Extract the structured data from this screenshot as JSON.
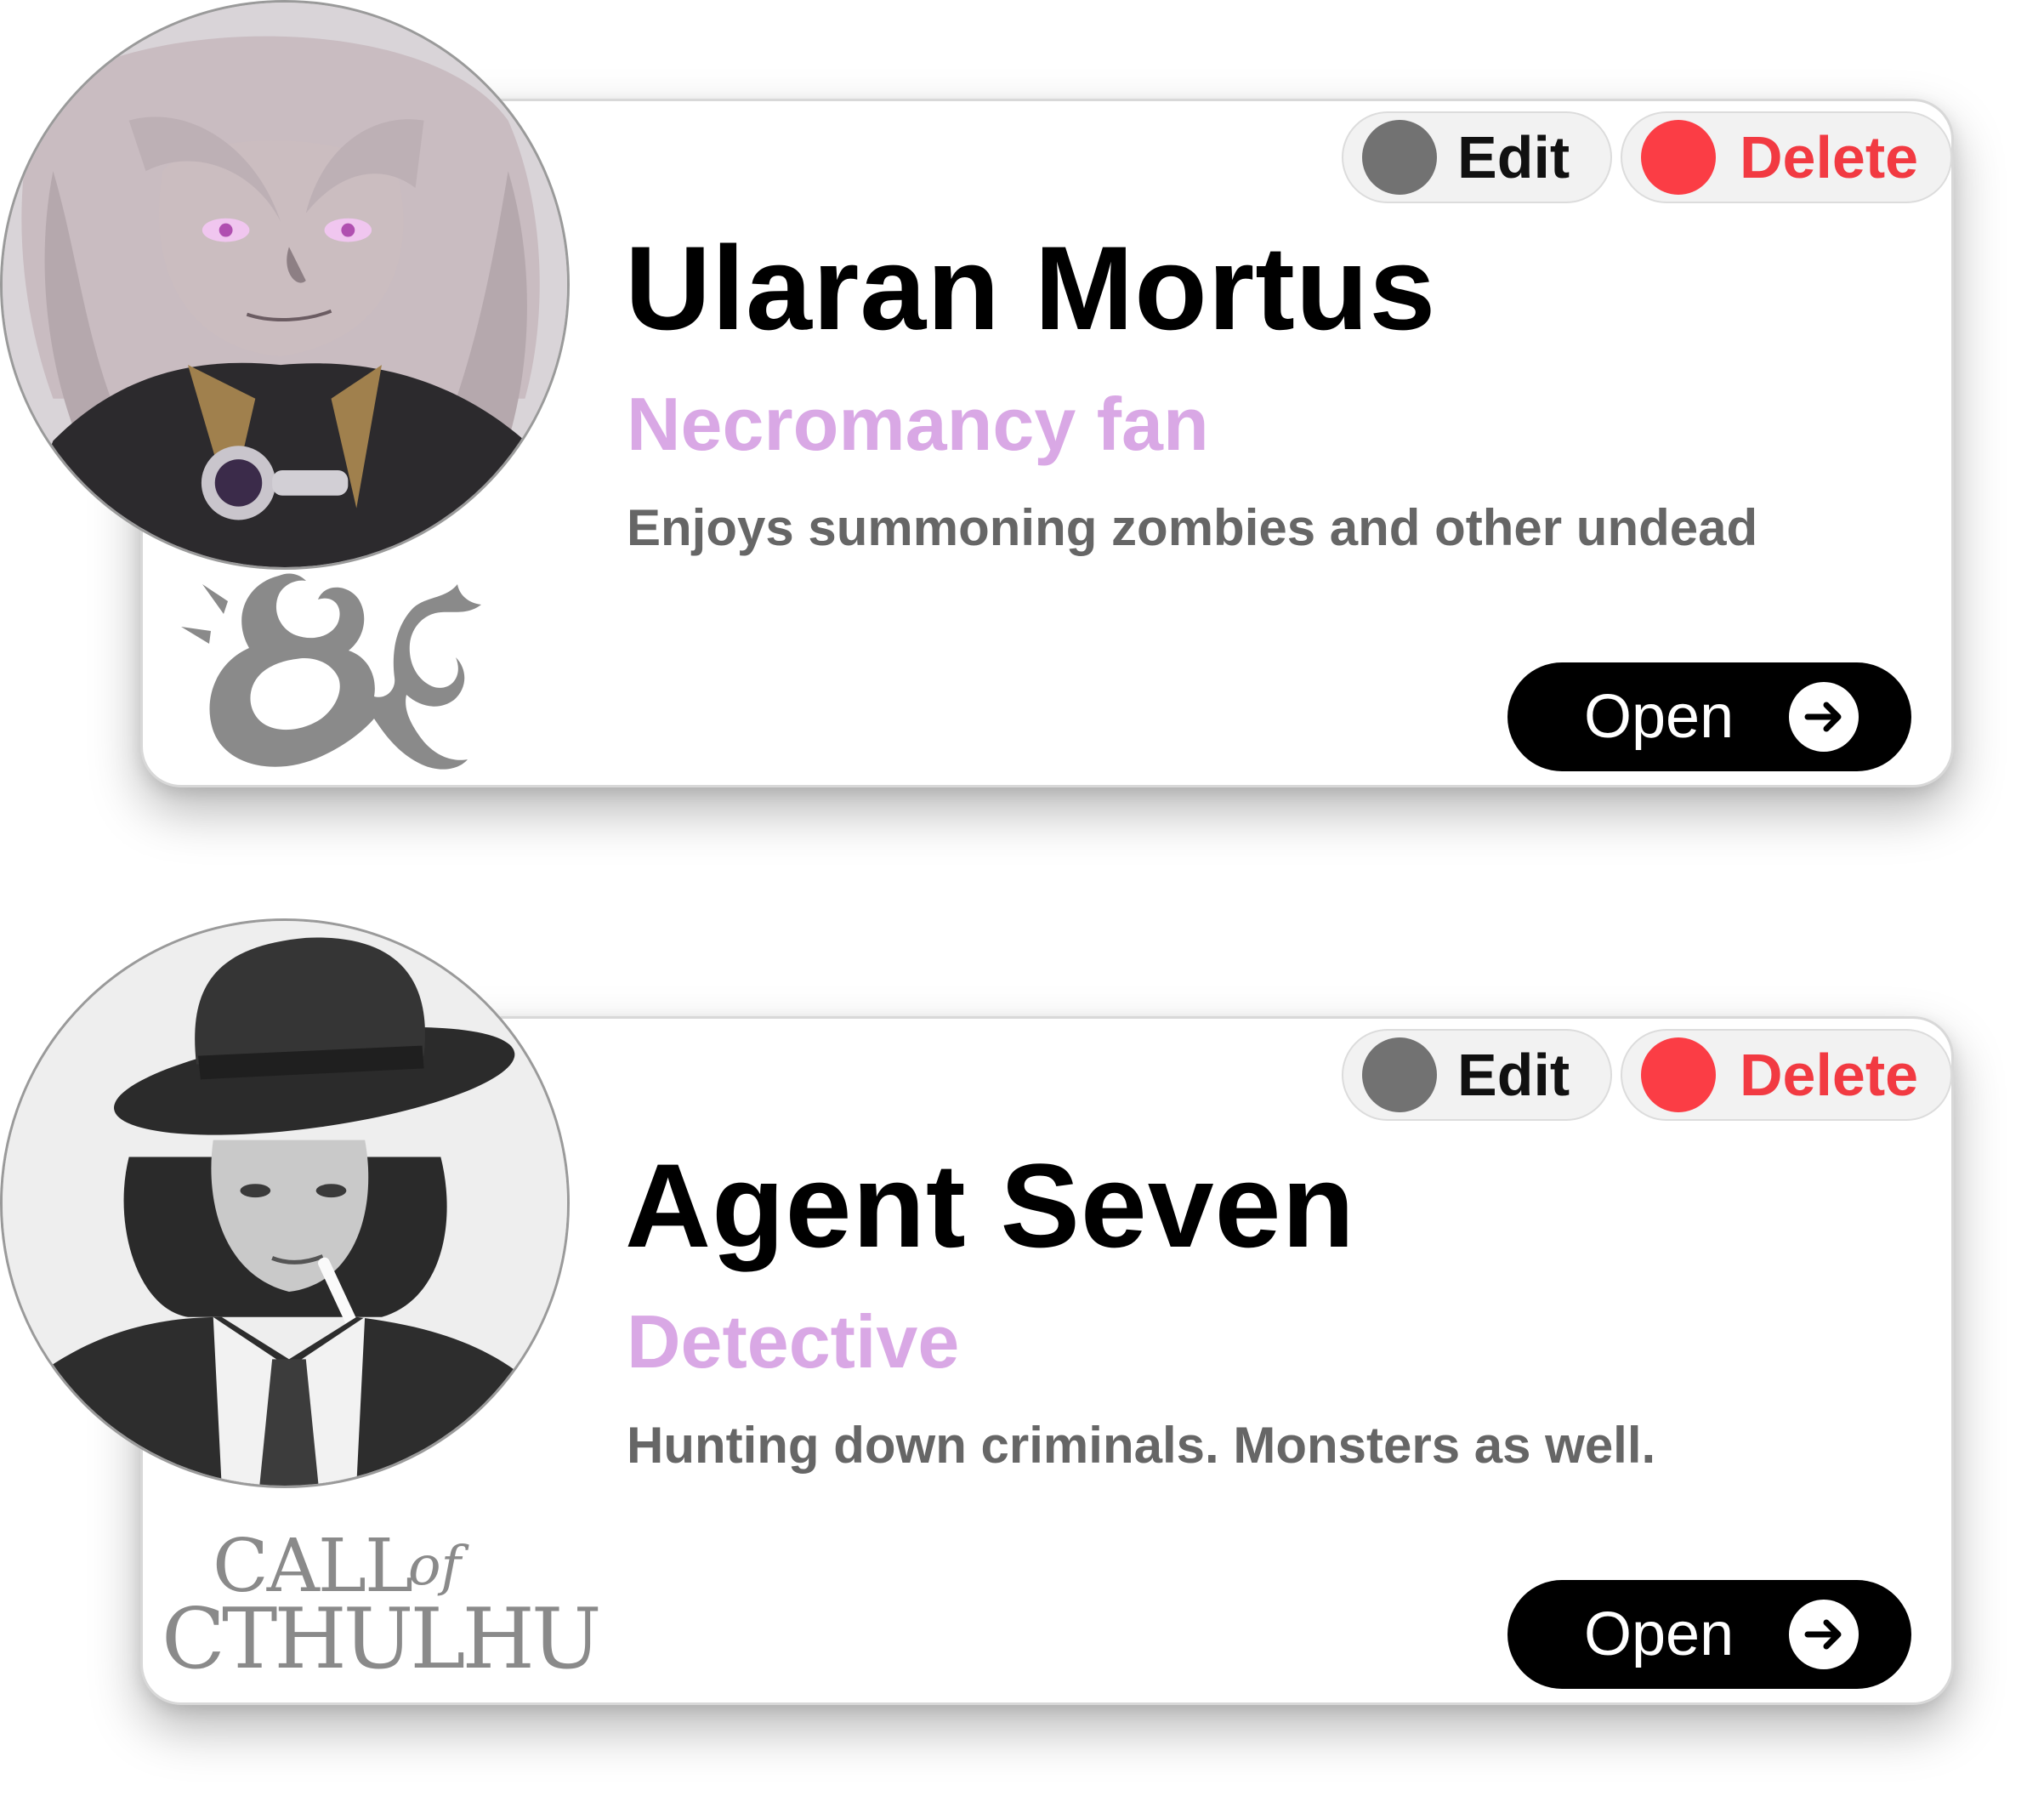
{
  "characters": [
    {
      "name": "Ularan Mortus",
      "role": "Necromancy fan",
      "description": "Enjoys summoning zombies and other undead",
      "edit_label": "Edit",
      "delete_label": "Delete",
      "open_label": "Open",
      "game_logo_text": "&",
      "avatar_icon": "anime-necromancer-portrait"
    },
    {
      "name": "Agent Seven",
      "role": "Detective",
      "description": "Hunting down criminals. Monsters as well.",
      "edit_label": "Edit",
      "delete_label": "Delete",
      "open_label": "Open",
      "game_logo_text": "CALL of CTHULHU",
      "avatar_icon": "detective-photo-portrait"
    }
  ],
  "colors": {
    "role": "#d9a8e5",
    "description": "#666666",
    "edit_dot": "#727272",
    "delete_dot": "#fb3d45",
    "delete_text": "#f23a42",
    "open_button": "#000000",
    "logo": "#8a8a8a"
  }
}
